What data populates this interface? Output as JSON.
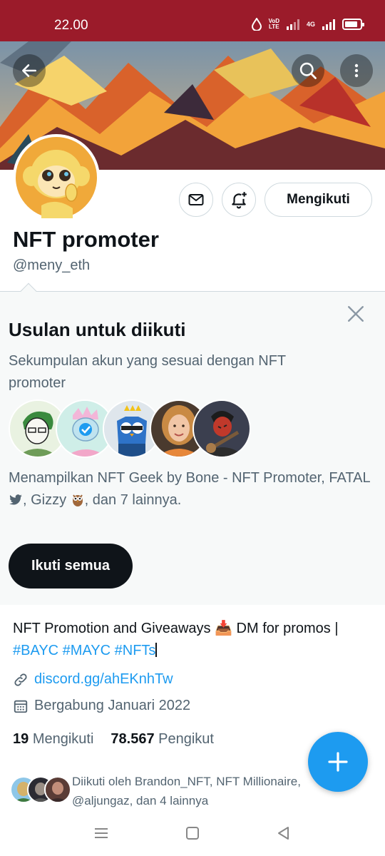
{
  "status_bar": {
    "time": "22.00",
    "vol_top": "VoD",
    "vol_bottom": "LTE",
    "network": "4G"
  },
  "profile": {
    "display_name": "NFT promoter",
    "handle": "@meny_eth",
    "follow_button": "Mengikuti"
  },
  "suggestions": {
    "title": "Usulan untuk diikuti",
    "subtitle": "Sekumpulan akun yang sesuai dengan NFT promoter",
    "description_prefix": "Menampilkan NFT Geek by Bone - NFT Promoter, FATAL ",
    "description_mid": ", Gizzy ",
    "description_suffix": ", dan 7 lainnya.",
    "follow_all": "Ikuti semua"
  },
  "bio": {
    "text": "NFT Promotion and Giveaways 📥 DM for promos |",
    "hashtags": "#BAYC #MAYC #NFTs"
  },
  "link": "discord.gg/ahEKnhTw",
  "joined": "Bergabung Januari 2022",
  "stats": {
    "following_count": "19",
    "following_label": "Mengikuti",
    "followers_count": "78.567",
    "followers_label": "Pengikut"
  },
  "followed_by": {
    "line1": "Diikuti oleh Brandon_NFT, NFT Millionaire,",
    "line2": "@aljungaz, dan 4 lainnya"
  },
  "colors": {
    "status_bar": "#9b1b2a",
    "accent": "#1d9bf0",
    "text": "#0f1419",
    "secondary_text": "#536471"
  }
}
